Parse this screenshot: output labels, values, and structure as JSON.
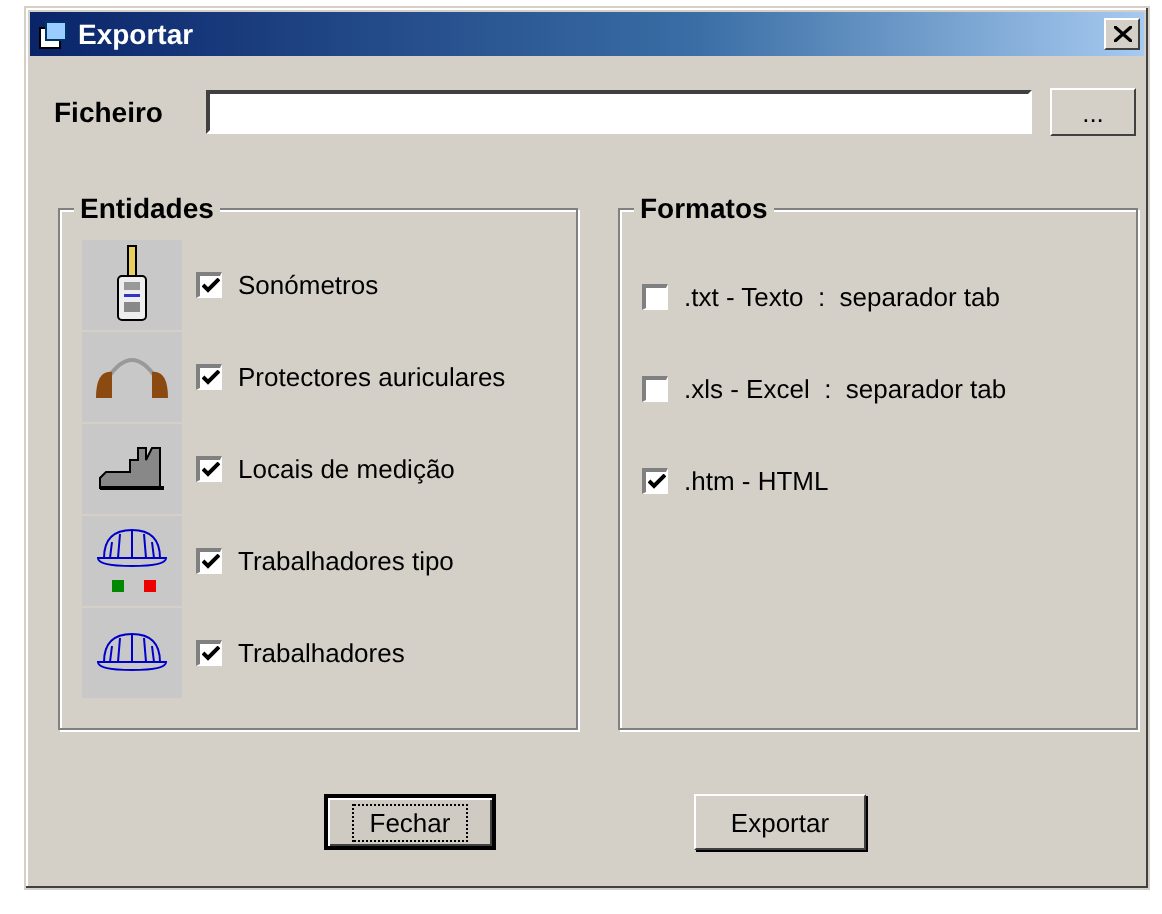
{
  "window": {
    "title": "Exportar"
  },
  "file": {
    "label": "Ficheiro",
    "browse": "..."
  },
  "entities": {
    "title": "Entidades",
    "items": [
      {
        "kind": "meter",
        "label": "Sonómetros",
        "checked": true
      },
      {
        "kind": "earmuffs",
        "label": "Protectores auriculares",
        "checked": true
      },
      {
        "kind": "factory",
        "label": "Locais de medição",
        "checked": true
      },
      {
        "kind": "helmet-types",
        "label": "Trabalhadores tipo",
        "checked": true
      },
      {
        "kind": "helmet",
        "label": "Trabalhadores",
        "checked": true
      }
    ]
  },
  "formats": {
    "title": "Formatos",
    "items": [
      {
        "label": ".txt - Texto  :  separador tab",
        "checked": false
      },
      {
        "label": ".xls - Excel  :  separador tab",
        "checked": false
      },
      {
        "label": ".htm - HTML",
        "checked": true
      }
    ]
  },
  "buttons": [
    {
      "label": "Fechar",
      "focused": true
    },
    {
      "label": "Exportar",
      "focused": false
    }
  ]
}
